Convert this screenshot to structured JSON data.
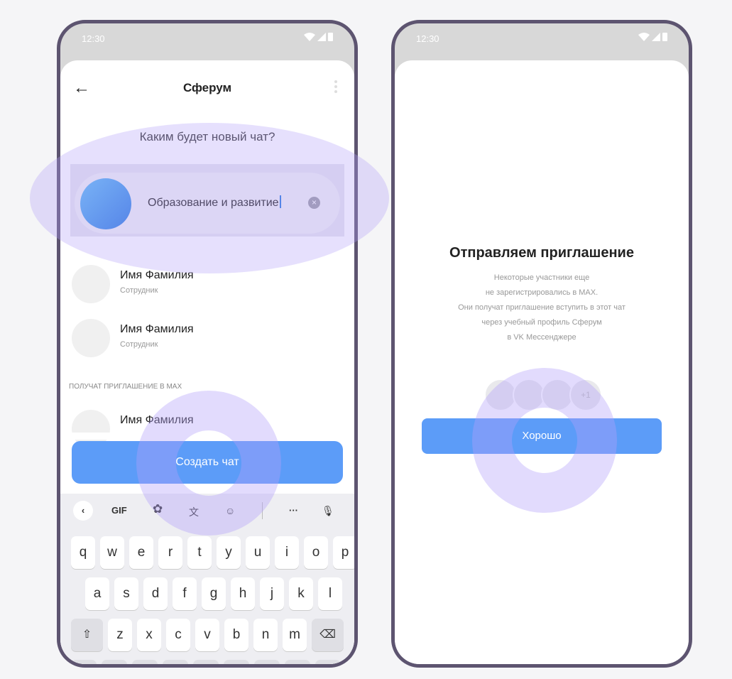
{
  "left_phone": {
    "status_time": "12:30",
    "header_title": "Сферум",
    "question": "Каким будет новый чат?",
    "chat_name_value": "Образование и развитие",
    "members": [
      {
        "name": "Имя Фамилия",
        "role": "Сотрудник"
      },
      {
        "name": "Имя Фамилия",
        "role": "Сотрудник"
      }
    ],
    "section_header": "ПОЛУЧАТ ПРИГЛАШЕНИЕ В MAX",
    "invited_members": [
      {
        "name": "Имя Фамилия"
      }
    ],
    "create_button_label": "Создать чат",
    "keyboard": {
      "toolbar": {
        "back": "‹",
        "gif": "GIF",
        "gear": "✿",
        "translate": "文",
        "sticker": "☺",
        "more": "···",
        "mic": "🎙"
      },
      "row1": [
        "q",
        "w",
        "e",
        "r",
        "t",
        "y",
        "u",
        "i",
        "o",
        "p"
      ],
      "row2": [
        "a",
        "s",
        "d",
        "f",
        "g",
        "h",
        "j",
        "k",
        "l"
      ],
      "row3": [
        "z",
        "x",
        "c",
        "v",
        "b",
        "n",
        "m"
      ],
      "shift_glyph": "⇧",
      "backspace_glyph": "⌫"
    }
  },
  "right_phone": {
    "status_time": "12:30",
    "modal_title": "Отправляем приглашение",
    "modal_lines": [
      "Некоторые участники еще",
      "не зарегистрировались в MAX.",
      "Они получат приглашение вступить в этот чат",
      "через учебный профиль Сферум",
      "в VK Мессенджере"
    ],
    "stack_more": "+1",
    "ok_button_label": "Хорошо"
  },
  "icons": [
    "back-arrow-icon",
    "kebab-menu-icon",
    "clear-icon",
    "wifi-icon",
    "signal-icon",
    "battery-icon",
    "gear-icon",
    "translate-icon",
    "sticker-icon",
    "more-icon",
    "mic-icon",
    "shift-icon",
    "backspace-icon"
  ],
  "colors": {
    "accent": "#5c9cf8",
    "frame": "#5d5470",
    "touch_highlight": "#b2a0fa"
  }
}
